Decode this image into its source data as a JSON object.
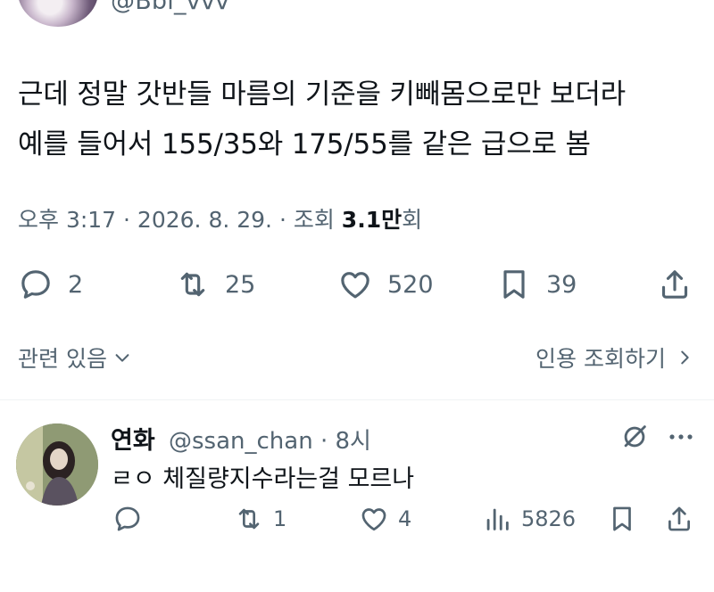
{
  "header": {
    "handle": "@Bbi_vvv"
  },
  "tweet": {
    "lines": [
      "근데 정말 갓반들 마름의 기준을 키빼몸으로만 보더라",
      "예를 들어서 155/35와 175/55를 같은 급으로 봄"
    ],
    "time": "오후 3:17 · 2026. 8. 29. · 조회 ",
    "views_number": "3.1",
    "views_unit": "만",
    "views_suffix": "회"
  },
  "actions": {
    "replies": "2",
    "retweets": "25",
    "likes": "520",
    "bookmarks": "39"
  },
  "related": {
    "label": "관련 있음",
    "quotes_label": "인용 조회하기"
  },
  "reply": {
    "name": "연화",
    "handle_time": "@ssan_chan · 8시",
    "text": "ㄹㅇ 체질량지수라는걸 모르나",
    "replies": "",
    "retweets": "1",
    "likes": "4",
    "views": "5826"
  },
  "colors": {
    "text": "#0f1419",
    "secondary": "#536471",
    "divider": "#eff3f4"
  }
}
